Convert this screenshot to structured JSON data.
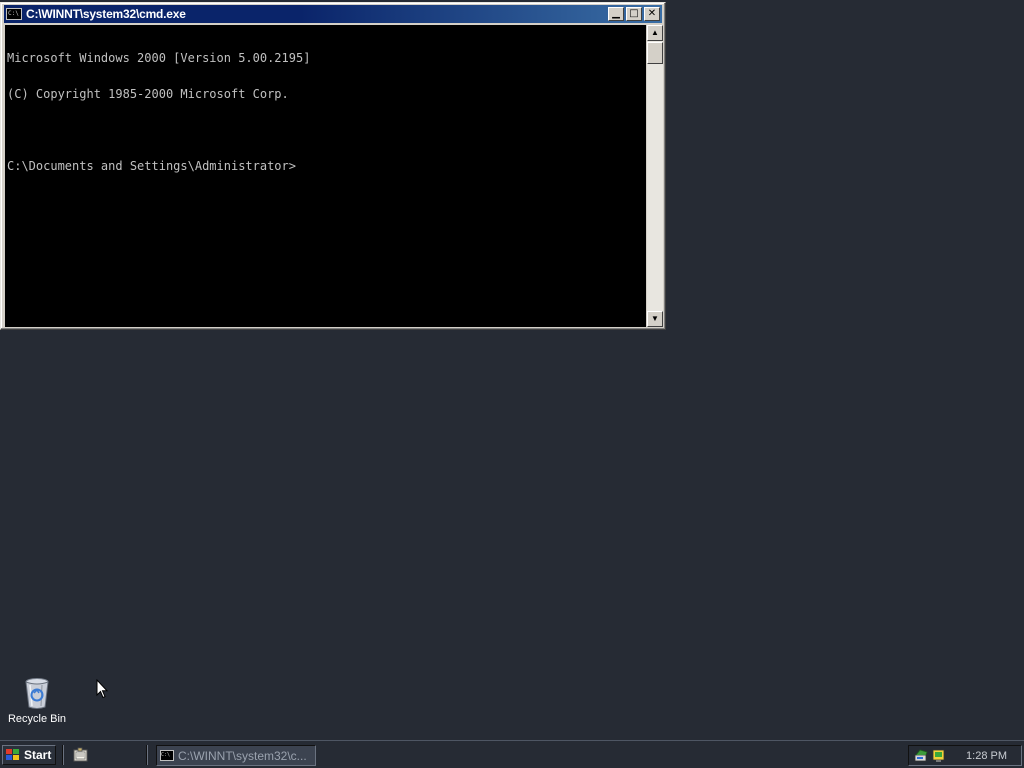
{
  "window": {
    "title": "C:\\WINNT\\system32\\cmd.exe",
    "icon_text": "C:\\",
    "buttons": {
      "minimize": "▁",
      "maximize": "□",
      "close": "✕"
    }
  },
  "console": {
    "lines": [
      "Microsoft Windows 2000 [Version 5.00.2195]",
      "(C) Copyright 1985-2000 Microsoft Corp.",
      "",
      "C:\\Documents and Settings\\Administrator>"
    ]
  },
  "scrollbar": {
    "up_arrow": "▲",
    "down_arrow": "▼"
  },
  "desktop": {
    "icons": [
      {
        "label": "Recycle Bin",
        "icon": "recycle-bin-icon"
      }
    ]
  },
  "taskbar": {
    "start_label": "Start",
    "tasks": [
      {
        "label": "C:\\WINNT\\system32\\c...",
        "icon_text": "C:\\"
      }
    ],
    "clock": "1:28 PM"
  }
}
